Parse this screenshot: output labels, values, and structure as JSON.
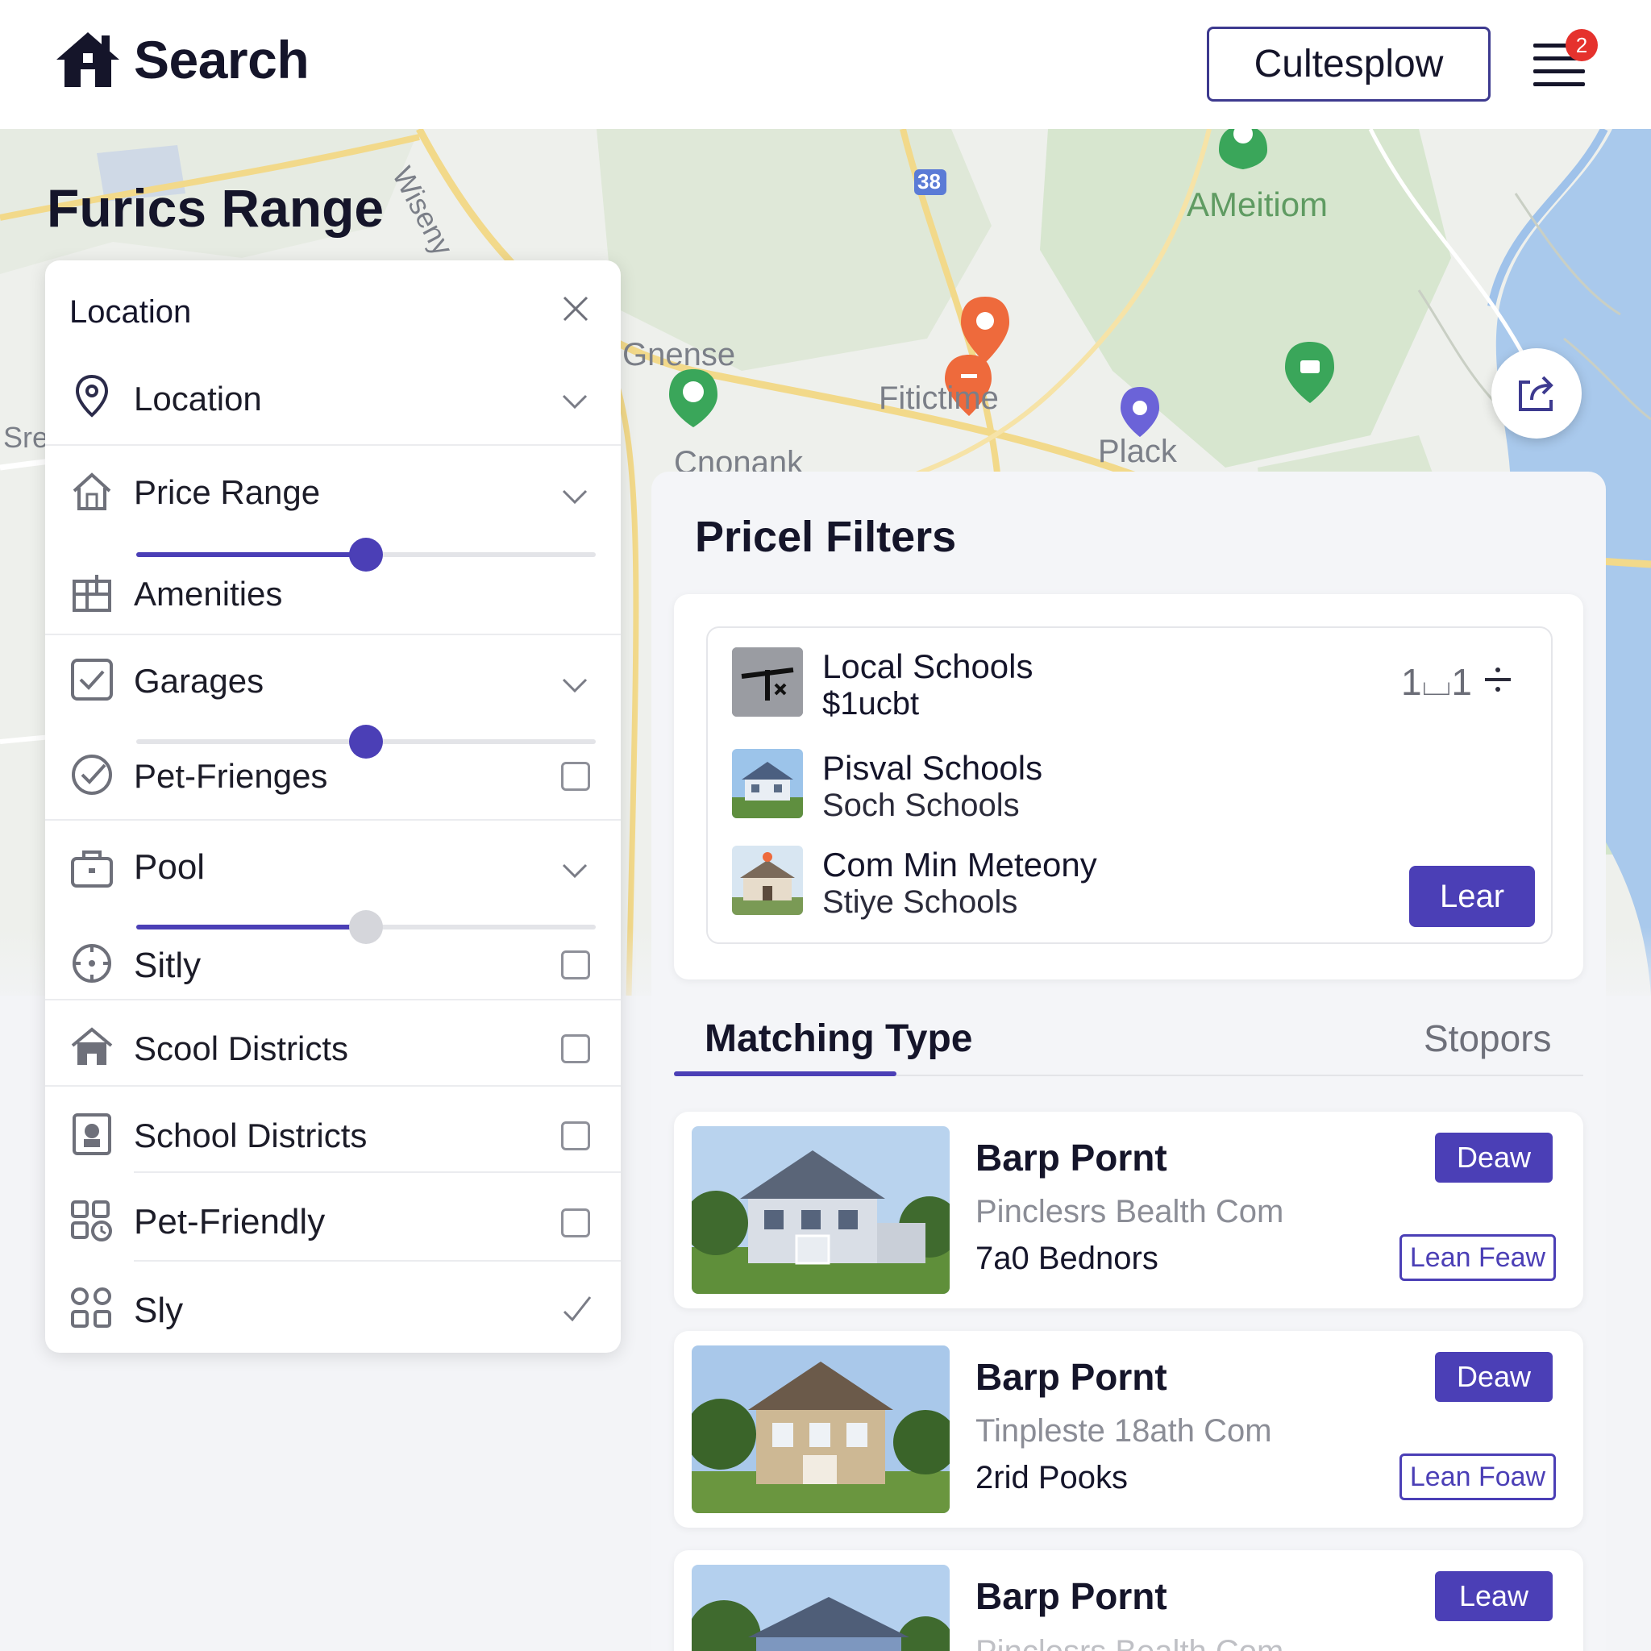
{
  "header": {
    "title": "Search",
    "button_label": "Cultesplow",
    "notification_count": "2"
  },
  "page_heading": "Furics Range",
  "map": {
    "labels": [
      "Wiseny",
      "AMeitiom",
      "Gnense",
      "Fitictime",
      "Plack",
      "Cnonank",
      "Sre",
      "38"
    ]
  },
  "filters": {
    "header": "Location",
    "items": [
      {
        "label": "Location",
        "icon": "map-pin-icon",
        "control": "dropdown"
      },
      {
        "label": "Price Range",
        "icon": "house-icon",
        "control": "dropdown",
        "slider": 0.5
      },
      {
        "label": "Amenities",
        "icon": "amenities-icon",
        "control": "none"
      },
      {
        "label": "Garages",
        "icon": "checkbox-icon",
        "control": "dropdown",
        "slider": 0.5
      },
      {
        "label": "Pet-Frienges",
        "icon": "check-circle-icon",
        "control": "checkbox"
      },
      {
        "label": "Pool",
        "icon": "briefcase-icon",
        "control": "dropdown",
        "slider": 0.5
      },
      {
        "label": "Sitly",
        "icon": "target-icon",
        "control": "checkbox"
      },
      {
        "label": "Scool Districts",
        "icon": "home-icon",
        "control": "checkbox"
      },
      {
        "label": "School Districts",
        "icon": "badge-icon",
        "control": "checkbox"
      },
      {
        "label": "Pet-Friendly",
        "icon": "grid-clock-icon",
        "control": "checkbox"
      },
      {
        "label": "Sly",
        "icon": "apps-icon",
        "control": "check"
      }
    ]
  },
  "price_filters": {
    "title": "Pricel Filters",
    "count_label": "1⌴1",
    "schools": [
      {
        "name": "Local Schools",
        "detail": "$1ucbt"
      },
      {
        "name": "Pisval Schools",
        "detail": "Soch Schools"
      },
      {
        "name": "Com Min Meteony",
        "detail": "Stiye Schools"
      }
    ],
    "learn_button": "Lear"
  },
  "tabs": {
    "active": "Matching Type",
    "secondary": "Stopors"
  },
  "listings": [
    {
      "title": "Barp Pornt",
      "subtitle": "Pinclesrs Bealth Com",
      "meta": "7a0 Bednors",
      "primary": "Deaw",
      "secondary": "Lean Feaw"
    },
    {
      "title": "Barp Pornt",
      "subtitle": "Tinpleste 18ath Com",
      "meta": "2rid Pooks",
      "primary": "Deaw",
      "secondary": "Lean Foaw"
    },
    {
      "title": "Barp Pornt",
      "subtitle": "Pinclesrs Bealth Com",
      "meta": "",
      "primary": "Leaw",
      "secondary": ""
    }
  ],
  "colors": {
    "accent": "#4b3fb6",
    "badge": "#e5322d",
    "pin_orange": "#ee6a3c",
    "pin_green": "#3aa65a",
    "pin_purple": "#6b63d8"
  }
}
